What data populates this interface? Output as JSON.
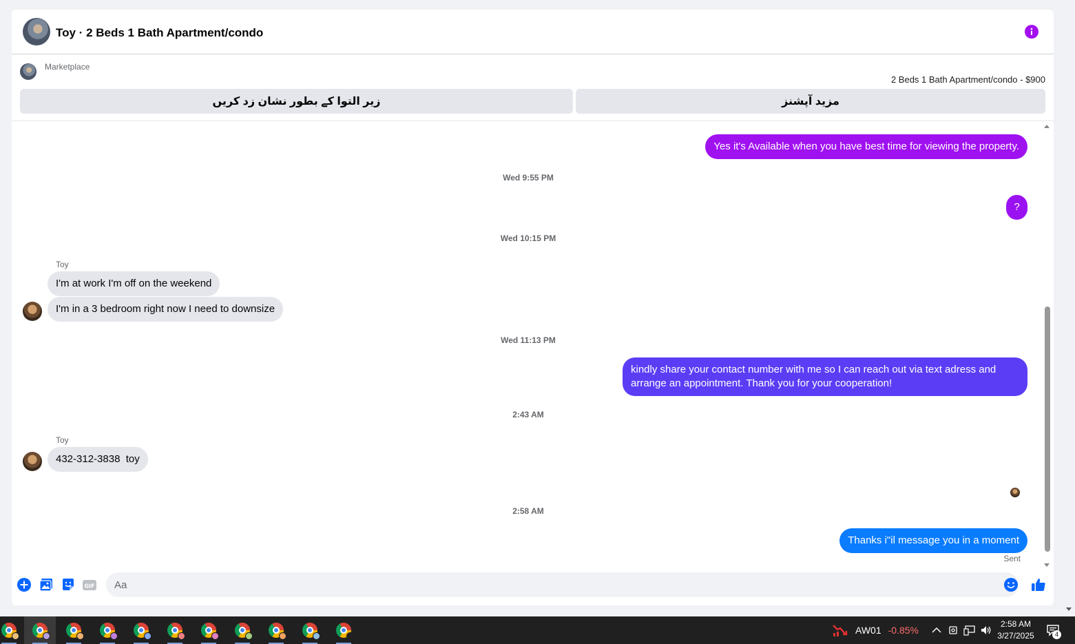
{
  "header": {
    "title": "Toy · 2 Beds 1 Bath Apartment/condo"
  },
  "marketplace": {
    "label": "Marketplace",
    "listing": "2 Beds 1 Bath Apartment/condo - $900",
    "mark_sold_label": "زیر التوا کے بطور نشان زد کریں",
    "more_options_label": "مزید آپشنز"
  },
  "messages": {
    "out1": "Yes it's Available when you have best time for viewing the property.",
    "ts1": "Wed 9:55 PM",
    "out2": "?",
    "ts2": "Wed 10:15 PM",
    "sender1": "Toy",
    "in1": "I'm at work I'm off on the weekend",
    "in2": "I'm in a 3 bedroom right now I need to downsize",
    "ts3": "Wed 11:13 PM",
    "out3": "kindly share your contact number with me so I can reach out via text adress and arrange an appointment. Thank you for your cooperation!",
    "ts4": "2:43 AM",
    "sender2": "Toy",
    "in3": "432-312-3838  toy",
    "ts5": "2:58 AM",
    "out4": "Thanks i\"il message you in a moment",
    "status": "Sent"
  },
  "composer": {
    "placeholder": "Aa"
  },
  "colors": {
    "purple": "#a011f0",
    "blue_purple": "#5b3df5",
    "blue": "#0a7cff",
    "accent": "#0866ff"
  },
  "taskbar": {
    "apps": 10,
    "stock_name": "AW01",
    "stock_change": "-0.85%",
    "time": "2:58 AM",
    "date": "3/27/2025",
    "notification_count": "4"
  }
}
